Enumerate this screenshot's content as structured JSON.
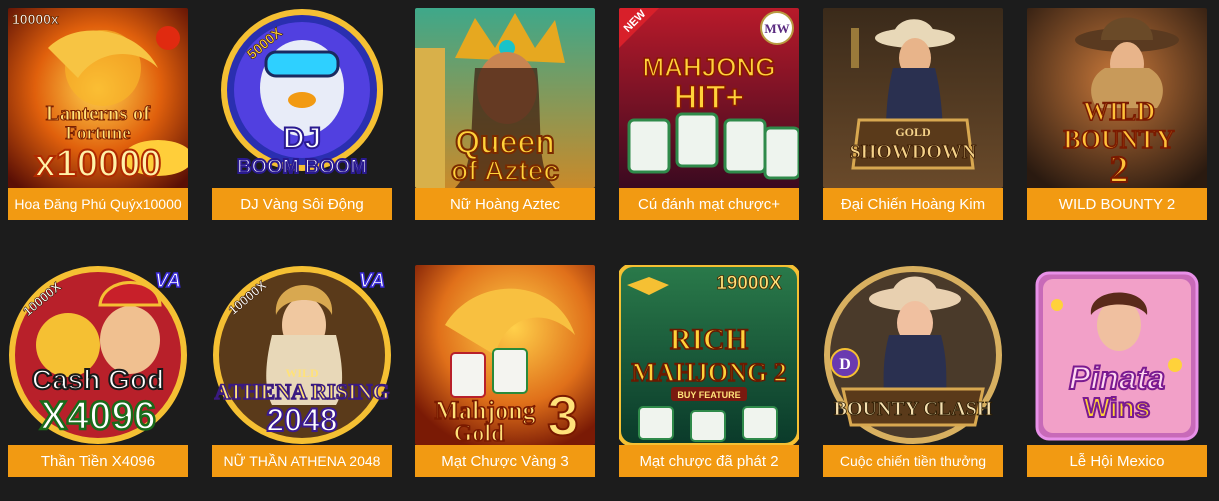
{
  "games": [
    {
      "title": "Hoa Đăng Phú Quýx10000",
      "art_text": [
        "10000x",
        "Lanterns of",
        "Fortune",
        "x10000"
      ],
      "icon": "golden-dragon-lanterns-art"
    },
    {
      "title": "DJ Vàng Sôi Động",
      "art_text": [
        "5000X",
        "DJ",
        "BOOM BOOM"
      ],
      "icon": "dj-penguin-art"
    },
    {
      "title": "Nữ Hoàng Aztec",
      "art_text": [
        "Queen",
        "of Aztec"
      ],
      "icon": "aztec-queen-art"
    },
    {
      "title": "Cú đánh mạt chược+",
      "art_text": [
        "NEW",
        "MAHJONG",
        "HIT+",
        "MW"
      ],
      "icon": "mahjong-tiles-art"
    },
    {
      "title": "Đại Chiến Hoàng Kim",
      "art_text": [
        "GOLD",
        "SHOWDOWN"
      ],
      "icon": "cowgirl-gunslinger-art"
    },
    {
      "title": "WILD BOUNTY 2",
      "art_text": [
        "WILD",
        "BOUNTY",
        "2"
      ],
      "icon": "wild-west-bounty-art"
    },
    {
      "title": "Thần Tiền X4096",
      "art_text": [
        "10000X",
        "VA",
        "Cash God",
        "X4096"
      ],
      "icon": "cash-god-art"
    },
    {
      "title": "NỮ THẦN ATHENA 2048",
      "art_text": [
        "10000X",
        "VA",
        "WILD",
        "ATHENA RISING",
        "2048"
      ],
      "icon": "athena-goddess-art"
    },
    {
      "title": "Mạt Chược Vàng 3",
      "art_text": [
        "Mahjong",
        "Gold",
        "3"
      ],
      "icon": "golden-dragon-mahjong-art"
    },
    {
      "title": "Mạt chược đã phát 2",
      "art_text": [
        "19000X",
        "RICH",
        "MAHJONG 2",
        "BUY FEATURE"
      ],
      "icon": "rich-mahjong-art"
    },
    {
      "title": "Cuộc chiến tiền thưởng",
      "art_text": [
        "D",
        "BOUNTY CLASH"
      ],
      "icon": "bounty-clash-cowgirl-art"
    },
    {
      "title": "Lễ Hội Mexico",
      "art_text": [
        "Pinata",
        "Wins"
      ],
      "icon": "pinata-party-art"
    }
  ],
  "colors": {
    "background": "#1c1c1c",
    "label_bg": "#f29a12",
    "label_text": "#ffffff"
  }
}
